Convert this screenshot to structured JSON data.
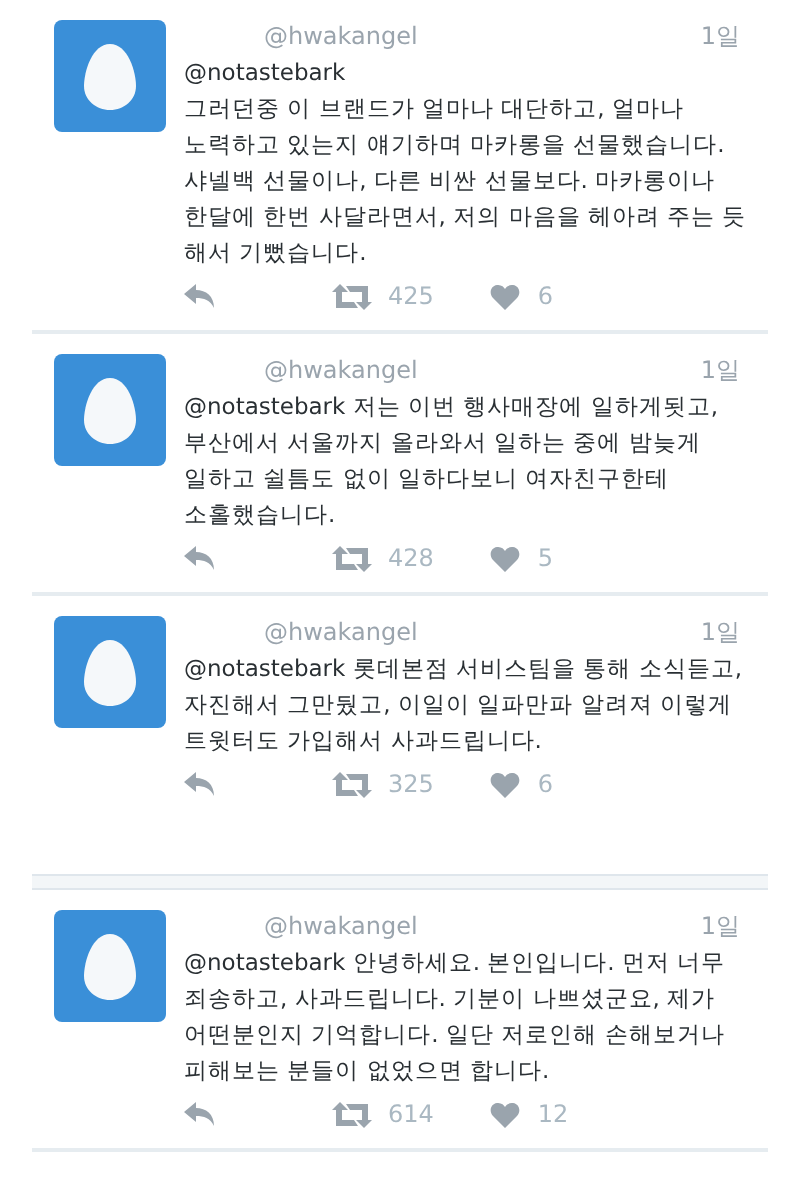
{
  "tweets": [
    {
      "handle": "@hwakangel",
      "time": "1일",
      "gap_after": false,
      "lines": [
        "@notastebark",
        "그러던중 이 브랜드가 얼마나 대단하고, 얼마나",
        "노력하고 있는지  얘기하며 마카롱을 선물했습니다.",
        "샤넬백 선물이나, 다른 비싼 선물보다. 마카롱이나",
        "한달에 한번 사달라면서, 저의 마음을 헤아려 주는 듯",
        "해서 기뻤습니다."
      ],
      "retweets": "425",
      "likes": "6"
    },
    {
      "handle": "@hwakangel",
      "time": "1일",
      "gap_after": false,
      "lines": [
        "@notastebark 저는 이번 행사매장에  일하게됫고,",
        "부산에서 서울까지 올라와서 일하는 중에 밤늦게",
        "일하고 쉴틈도 없이 일하다보니 여자친구한테",
        "소홀했습니다."
      ],
      "retweets": "428",
      "likes": "5"
    },
    {
      "handle": "@hwakangel",
      "time": "1일",
      "gap_after": true,
      "lines": [
        "@notastebark 롯데본점 서비스팀을 통해 소식듣고,",
        "자진해서 그만뒀고, 이일이 일파만파 알려져 이렇게",
        "트윗터도 가입해서 사과드립니다."
      ],
      "retweets": "325",
      "likes": "6"
    },
    {
      "handle": "@hwakangel",
      "time": "1일",
      "gap_after": false,
      "lines": [
        "@notastebark 안녕하세요. 본인입니다. 먼저 너무",
        "죄송하고, 사과드립니다. 기분이 나쁘셨군요, 제가",
        "어떤분인지 기억합니다. 일단 저로인해 손해보거나",
        "피해보는 분들이 없었으면 합니다."
      ],
      "retweets": "614",
      "likes": "12"
    }
  ]
}
